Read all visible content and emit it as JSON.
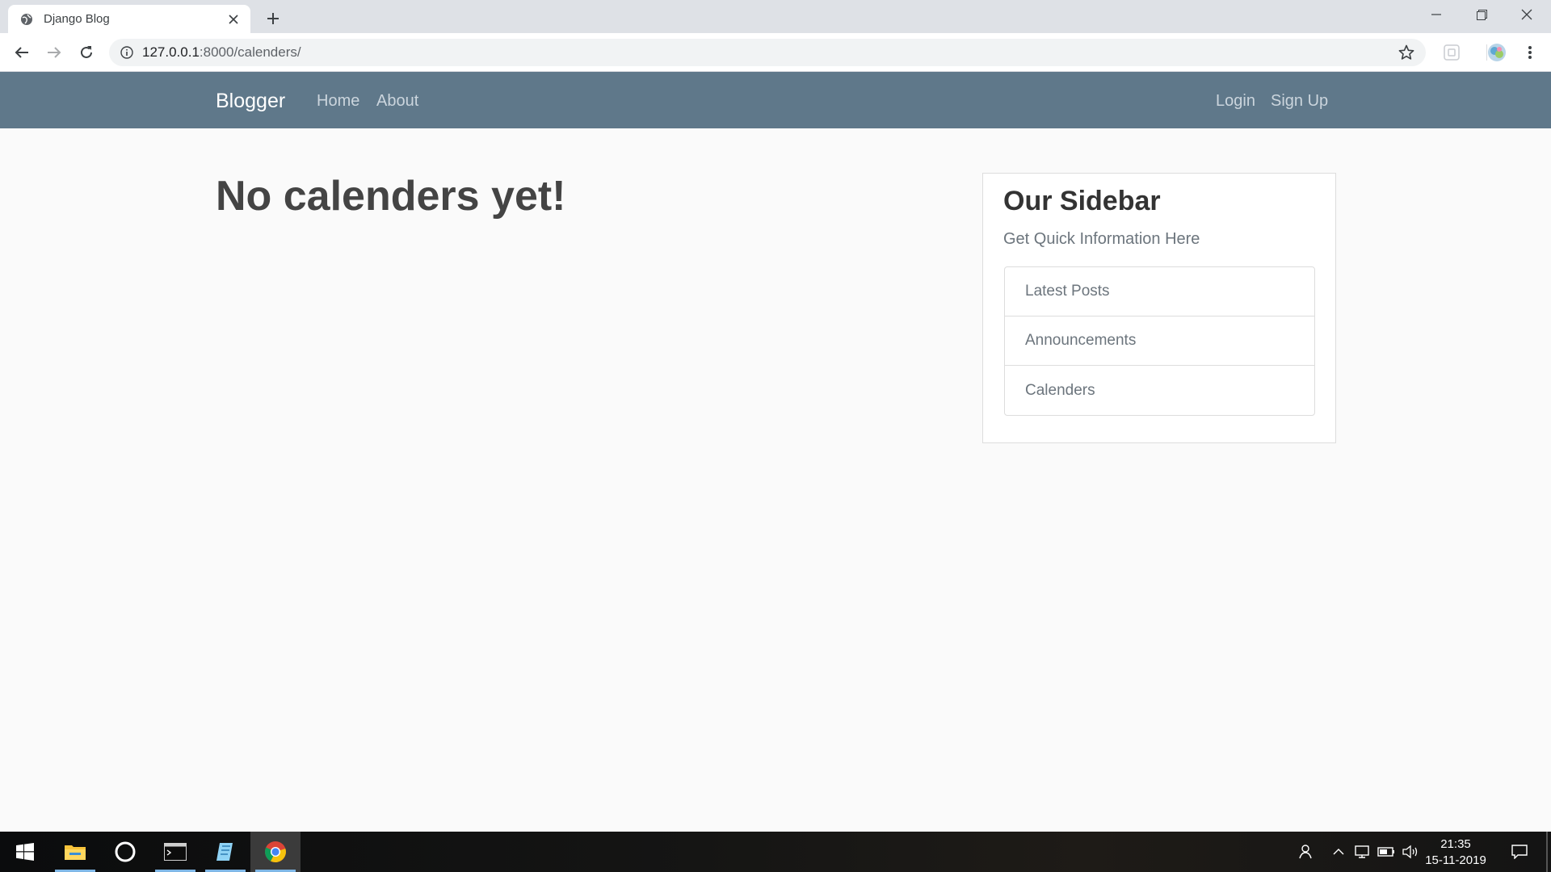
{
  "browser": {
    "tab_title": "Django Blog",
    "url_host": "127.0.0.1",
    "url_path": ":8000/calenders/"
  },
  "site": {
    "brand": "Blogger",
    "nav_left": [
      "Home",
      "About"
    ],
    "nav_right": [
      "Login",
      "Sign Up"
    ],
    "nav_color": "#5f788a"
  },
  "main": {
    "heading": "No calenders yet!"
  },
  "sidebar": {
    "title": "Our Sidebar",
    "subtitle": "Get Quick Information Here",
    "items": [
      "Latest Posts",
      "Announcements",
      "Calenders"
    ]
  },
  "taskbar": {
    "time": "21:35",
    "date": "15-11-2019",
    "apps": [
      "start-icon",
      "file-explorer-icon",
      "cortana-icon",
      "terminal-icon",
      "notes-icon",
      "chrome-icon"
    ]
  }
}
